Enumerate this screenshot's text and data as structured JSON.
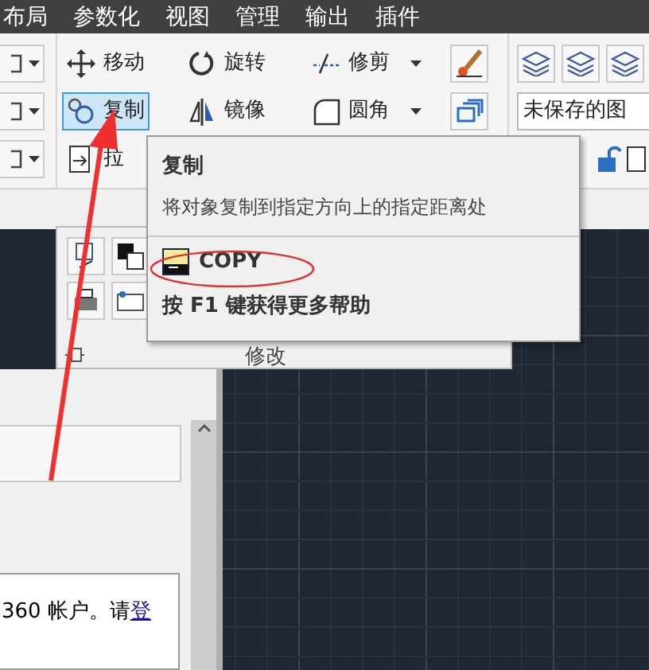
{
  "menu": [
    {
      "label": "布局"
    },
    {
      "label": "参数化"
    },
    {
      "label": "视图"
    },
    {
      "label": "管理"
    },
    {
      "label": "输出"
    },
    {
      "label": "插件"
    }
  ],
  "modify_tools": [
    {
      "label": "移动",
      "selected": false,
      "dropdown": false
    },
    {
      "label": "旋转",
      "selected": false,
      "dropdown": false
    },
    {
      "label": "修剪",
      "selected": false,
      "dropdown": true
    },
    {
      "label": "复制",
      "selected": true,
      "dropdown": false
    },
    {
      "label": "镜像",
      "selected": false,
      "dropdown": false
    },
    {
      "label": "圆角",
      "selected": false,
      "dropdown": true
    },
    {
      "label": "拉",
      "selected": false,
      "dropdown": false
    }
  ],
  "layer_field": {
    "value": "未保存的图"
  },
  "panel_title": "修改",
  "tooltip": {
    "title": "复制",
    "description": "将对象复制到指定方向上的指定距离处",
    "command": "COPY",
    "help": "按 F1 键获得更多帮助"
  },
  "palette": {
    "text": "360 帐户。请",
    "link": "登"
  }
}
